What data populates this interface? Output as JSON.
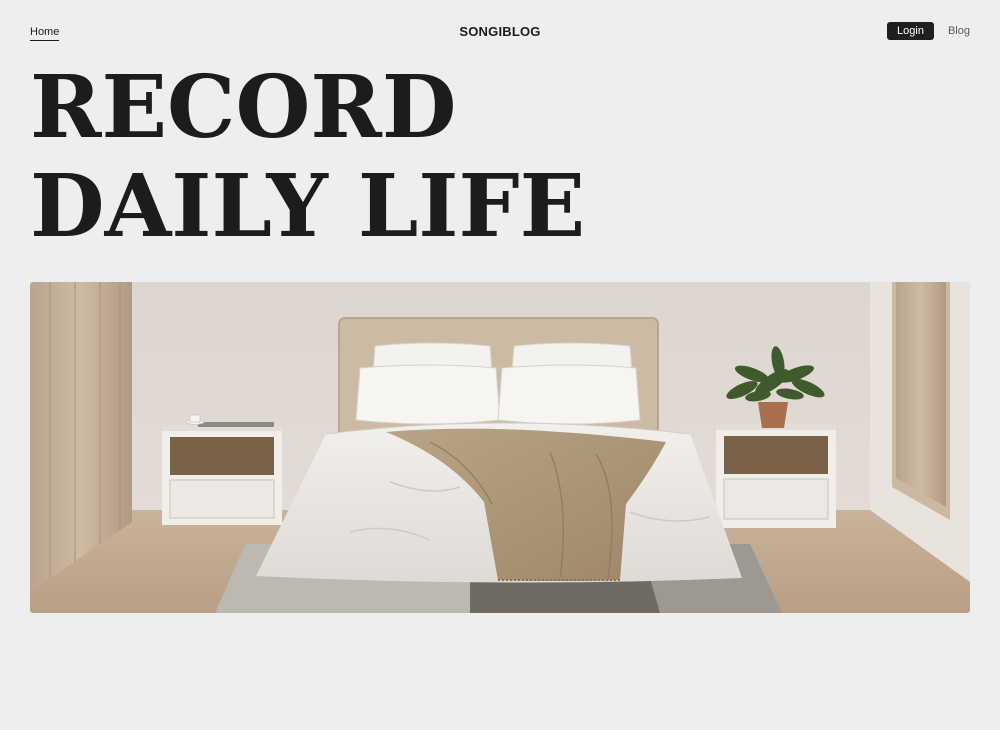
{
  "nav": {
    "home_label": "Home",
    "brand": "SONGIBLOG",
    "login_label": "Login",
    "blog_label": "Blog"
  },
  "hero": {
    "title_line1": "RECORD",
    "title_line2": "DAILY LIFE"
  },
  "colors": {
    "background": "#eeeeee",
    "text": "#1c1c1c",
    "button": "#1f1f1f"
  }
}
